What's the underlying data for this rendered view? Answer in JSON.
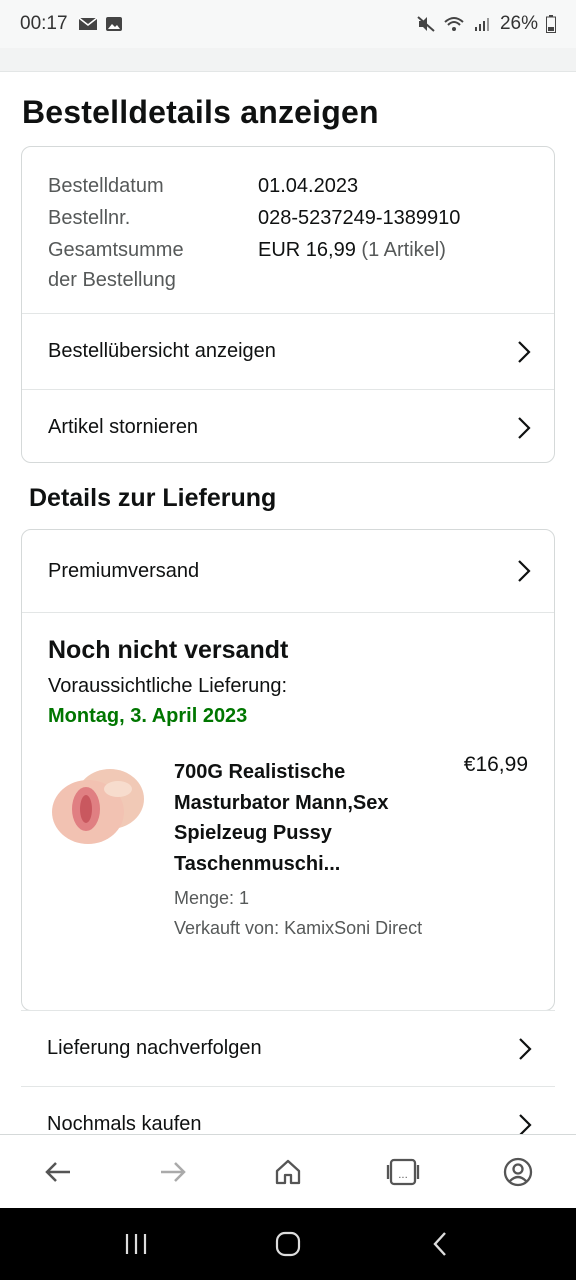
{
  "status_bar": {
    "time": "00:17",
    "battery": "26%",
    "icons": [
      "mail-icon",
      "image-icon",
      "mute-icon",
      "wifi-icon",
      "signal-icon",
      "battery-icon"
    ]
  },
  "page": {
    "title": "Bestelldetails anzeigen"
  },
  "order_info": {
    "date_label": "Bestelldatum",
    "date_value": "01.04.2023",
    "number_label": "Bestellnr.",
    "number_value": "028-5237249-1389910",
    "total_label_line1": "Gesamtsumme",
    "total_label_line2": "der Bestellung",
    "total_value": "EUR 16,99",
    "total_count": "(1 Artikel)"
  },
  "order_actions": [
    {
      "label": "Bestellübersicht anzeigen"
    },
    {
      "label": "Artikel stornieren"
    }
  ],
  "delivery": {
    "section_title": "Details zur Lieferung",
    "shipping_method": "Premiumversand",
    "status": "Noch nicht versandt",
    "eta_label": "Voraussichtliche Lieferung:",
    "eta_date": "Montag, 3. April 2023",
    "item": {
      "title": "700G Realistische Masturbator Mann,Sex Spielzeug Pussy Taschenmuschi...",
      "price": "€16,99",
      "quantity": "Menge: 1",
      "seller": "Verkauft von: KamixSoni Direct"
    }
  },
  "more_actions": [
    {
      "label": "Lieferung nachverfolgen"
    },
    {
      "label": "Nochmals kaufen"
    }
  ],
  "bottom_nav": [
    "back-icon",
    "forward-icon",
    "home-icon",
    "tabs-icon",
    "account-icon"
  ],
  "colors": {
    "delivery_green": "#007600",
    "border": "#d5d9d9",
    "muted_text": "#565959"
  }
}
